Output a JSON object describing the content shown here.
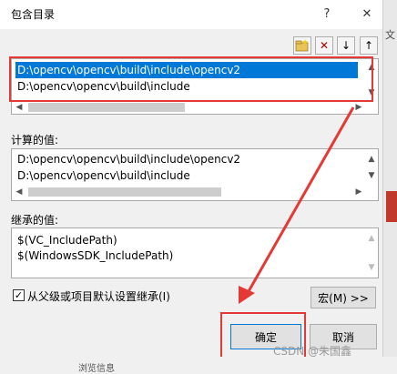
{
  "window": {
    "title": "包含目录",
    "help_glyph": "?",
    "close_glyph": "✕"
  },
  "bg_app": {
    "right_text": "文",
    "bottom_text": "浏览信息"
  },
  "toolbar": {
    "new_line_icon": "new-folder-icon",
    "delete_icon": "delete-icon",
    "down_icon": "arrow-down-icon",
    "up_icon": "arrow-up-icon",
    "delete_glyph": "✕",
    "down_glyph": "↓",
    "up_glyph": "↑"
  },
  "include_list": {
    "items": [
      "D:\\opencv\\opencv\\build\\include\\opencv2",
      "D:\\opencv\\opencv\\build\\include"
    ],
    "selected_index": 0
  },
  "evaluated": {
    "label": "计算的值:",
    "items": [
      "D:\\opencv\\opencv\\build\\include\\opencv2",
      "D:\\opencv\\opencv\\build\\include"
    ]
  },
  "inherited": {
    "label": "继承的值:",
    "items": [
      "$(VC_IncludePath)",
      "$(WindowsSDK_IncludePath)"
    ]
  },
  "inherit_checkbox": {
    "label": "从父级或项目默认设置继承(I)",
    "checked": true,
    "check_glyph": "✓"
  },
  "buttons": {
    "macro": "宏(M) >>",
    "ok": "确定",
    "cancel": "取消"
  },
  "watermark": "CSDN @朱国鑫",
  "colors": {
    "selection": "#0078d7",
    "annotation": "#e53935"
  }
}
